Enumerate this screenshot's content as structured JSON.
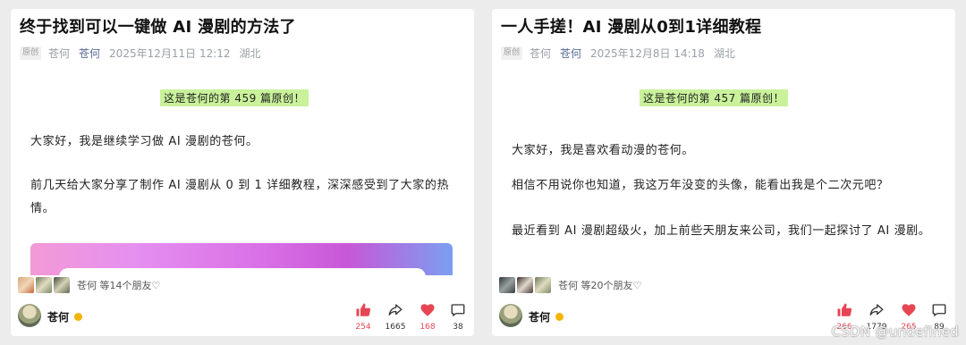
{
  "colors": {
    "accent_red": "#e64553",
    "highlight": "#c9f29b",
    "author_link": "#576b95",
    "verified": "#f5b400"
  },
  "cards": [
    {
      "title": "终于找到可以一键做 AI 漫剧的方法了",
      "tag": "原创",
      "author": "苍何",
      "account": "苍何",
      "date": "2025年12月11日 12:12",
      "location": "湖北",
      "highlight": "这是苍何的第 459 篇原创！",
      "paragraphs": [
        "大家好，我是继续学习做 AI 漫剧的苍何。",
        "前几天给大家分享了制作 AI 漫剧从 0 到 1 详细教程，深深感受到了大家的热情。"
      ],
      "friends_text": "苍何 等14个朋友♡",
      "footer_name": "苍何",
      "actions": [
        {
          "icon": "thumbs-up-icon",
          "count": "254"
        },
        {
          "icon": "share-icon",
          "count": "1665"
        },
        {
          "icon": "heart-icon",
          "count": "168"
        },
        {
          "icon": "comment-icon",
          "count": "38"
        }
      ]
    },
    {
      "title": "一人手搓！AI 漫剧从0到1详细教程",
      "tag": "原创",
      "author": "苍何",
      "account": "苍何",
      "date": "2025年12月8日 14:18",
      "location": "湖北",
      "highlight": "这是苍何的第 457 篇原创！",
      "paragraphs": [
        "大家好，我是喜欢看动漫的苍何。",
        "相信不用说你也知道，我这万年没变的头像，能看出我是个二次元吧？",
        "最近看到 AI 漫剧超级火，加上前些天朋友来公司，我们一起探讨了 AI 漫剧。"
      ],
      "friends_text": "苍何 等20个朋友♡",
      "footer_name": "苍何",
      "actions": [
        {
          "icon": "thumbs-up-icon",
          "count": "266"
        },
        {
          "icon": "share-icon",
          "count": "1779"
        },
        {
          "icon": "heart-icon",
          "count": "265"
        },
        {
          "icon": "comment-icon",
          "count": "89"
        }
      ]
    }
  ],
  "watermark": "CSDN @undefined"
}
